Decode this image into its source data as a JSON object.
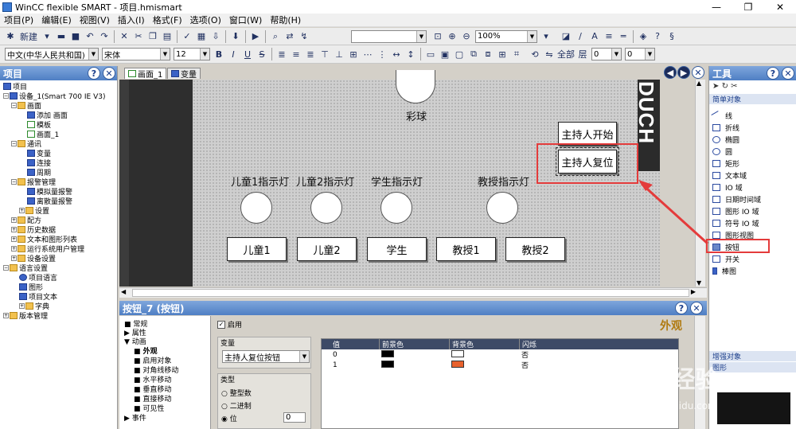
{
  "window": {
    "title": "WinCC flexible SMART - 项目.hmismart",
    "minimize": "—",
    "restore": "❐",
    "close": "✕"
  },
  "menu": [
    "项目(P)",
    "编辑(E)",
    "视图(V)",
    "插入(I)",
    "格式(F)",
    "选项(O)",
    "窗口(W)",
    "帮助(H)"
  ],
  "toolbar1": {
    "new_label": "新建",
    "zoom_value": "100%"
  },
  "toolbar2": {
    "language": "中文(中华人民共和国)",
    "font": "宋体",
    "font_size": "12",
    "layer_label": "全部",
    "layer_name": "层",
    "spin1": "0",
    "spin2": "0"
  },
  "project_panel": {
    "title": "项目",
    "items": [
      {
        "label": "项目"
      },
      {
        "label": "设备_1(Smart 700 IE V3)"
      },
      {
        "label": "画面"
      },
      {
        "label": "添加 画面"
      },
      {
        "label": "模板"
      },
      {
        "label": "画面_1"
      },
      {
        "label": "通讯"
      },
      {
        "label": "变量"
      },
      {
        "label": "连接"
      },
      {
        "label": "周期"
      },
      {
        "label": "报警管理"
      },
      {
        "label": "模拟量报警"
      },
      {
        "label": "离散量报警"
      },
      {
        "label": "设置"
      },
      {
        "label": "配方"
      },
      {
        "label": "历史数据"
      },
      {
        "label": "文本和图形列表"
      },
      {
        "label": "运行系统用户管理"
      },
      {
        "label": "设备设置"
      },
      {
        "label": "语言设置"
      },
      {
        "label": "项目语言"
      },
      {
        "label": "图形"
      },
      {
        "label": "项目文本"
      },
      {
        "label": "字典"
      },
      {
        "label": "版本管理"
      }
    ]
  },
  "editor": {
    "tabs": [
      {
        "label": "画面_1"
      },
      {
        "label": "变量"
      }
    ],
    "right_strip_text": "DUCH",
    "screen": {
      "top_label": "彩球",
      "indicator_labels": [
        "儿童1指示灯",
        "儿童2指示灯",
        "学生指示灯",
        "教授指示灯"
      ],
      "buttons": [
        "儿童1",
        "儿童2",
        "学生",
        "教授1",
        "教授2"
      ],
      "host_start": "主持人开始",
      "host_reset": "主持人复位"
    }
  },
  "properties": {
    "title": "按钮_7 (按钮)",
    "nav": [
      {
        "label": "常规"
      },
      {
        "label": "属性"
      },
      {
        "label": "动画"
      },
      {
        "label": "外观"
      },
      {
        "label": "启用对象"
      },
      {
        "label": "对角线移动"
      },
      {
        "label": "水平移动"
      },
      {
        "label": "垂直移动"
      },
      {
        "label": "直接移动"
      },
      {
        "label": "可见性"
      },
      {
        "label": "事件"
      }
    ],
    "enabled_label": "启用",
    "section_title": "外观",
    "variable_group": "变量",
    "variable_value": "主持人复位按钮",
    "type_group": "类型",
    "type_options": [
      {
        "label": "整型数"
      },
      {
        "label": "二进制"
      },
      {
        "label": "位"
      }
    ],
    "bit_value": "0",
    "table_headers": [
      "值",
      "前景色",
      "背景色",
      "闪烁"
    ],
    "rows": [
      {
        "value": "0",
        "fg": "#000000",
        "bg": "#ffffff",
        "blink": "否"
      },
      {
        "value": "1",
        "fg": "#000000",
        "bg": "#e8612c",
        "blink": "否"
      }
    ]
  },
  "tools_panel": {
    "title": "工具",
    "section": "简单对象",
    "items": [
      {
        "label": "线"
      },
      {
        "label": "折线"
      },
      {
        "label": "椭圆"
      },
      {
        "label": "圆"
      },
      {
        "label": "矩形"
      },
      {
        "label": "文本域"
      },
      {
        "label": "IO 域"
      },
      {
        "label": "日期时间域"
      },
      {
        "label": "图形 IO 域"
      },
      {
        "label": "符号 IO 域"
      },
      {
        "label": "图形视图"
      },
      {
        "label": "按钮"
      },
      {
        "label": "开关"
      },
      {
        "label": "棒图"
      }
    ],
    "section2": "增强对象",
    "section3": "图形"
  },
  "watermark": {
    "brand": "Baidu经验",
    "url": "jingyan.baidu.com"
  },
  "colors": {
    "highlight": "#e43b3b",
    "header": "#4f7fc4",
    "accent_orange": "#e8612c"
  }
}
